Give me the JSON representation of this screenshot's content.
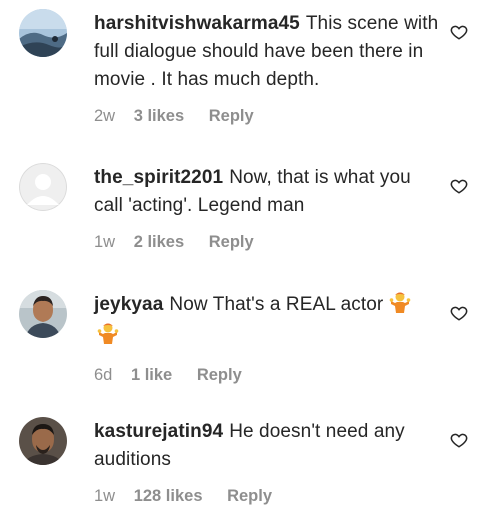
{
  "comments": [
    {
      "username": "harshitvishwakarma45",
      "text": "This scene with full dialogue should have been there in movie . It has much depth.",
      "time": "2w",
      "likes": "3 likes",
      "reply": "Reply",
      "avatar": "landscape-photo",
      "emojis": []
    },
    {
      "username": "the_spirit2201",
      "text": "Now, that is what you call 'acting'. Legend man",
      "time": "1w",
      "likes": "2 likes",
      "reply": "Reply",
      "avatar": "default-user",
      "emojis": []
    },
    {
      "username": "jeykyaa",
      "text": "Now That's a REAL actor",
      "time": "6d",
      "likes": "1 like",
      "reply": "Reply",
      "avatar": "person-photo",
      "emojis": [
        "person-shrugging-emoji",
        "person-shrugging-emoji"
      ]
    },
    {
      "username": "kasturejatin94",
      "text": "He doesn't need any auditions",
      "time": "1w",
      "likes": "128 likes",
      "reply": "Reply",
      "avatar": "person-photo",
      "emojis": []
    }
  ],
  "icons": {
    "like": "heart-outline-icon"
  },
  "colors": {
    "text": "#262626",
    "secondary": "#8e8e8e",
    "background": "#ffffff"
  }
}
